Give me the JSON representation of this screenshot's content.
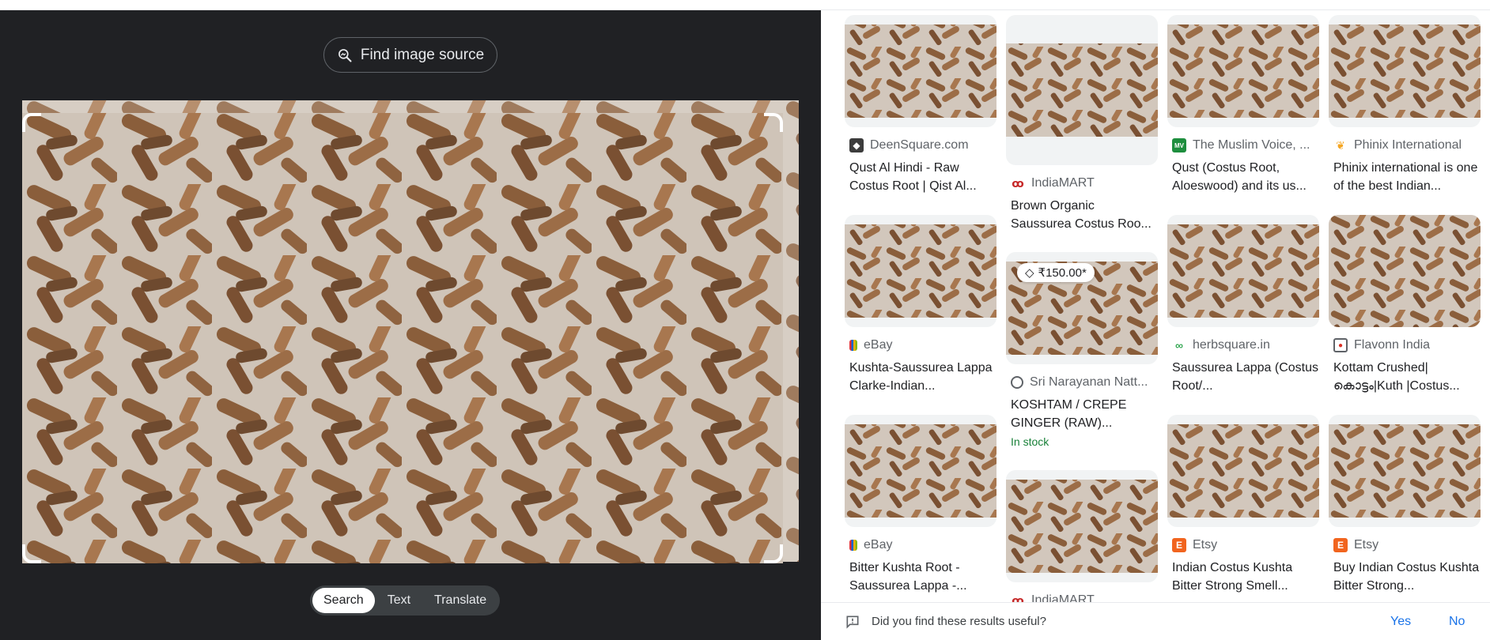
{
  "lens": {
    "find_source_label": "Find image source",
    "modes": [
      "Search",
      "Text",
      "Translate"
    ],
    "active_mode": "Search"
  },
  "results": [
    {
      "source": "DeenSquare.com",
      "title": "Qust Al Hindi - Raw Costus Root | Qist Al...",
      "favicon": "deensquare-icon"
    },
    {
      "source": "IndiaMART",
      "title": "Brown Organic Saussurea Costus Roo...",
      "favicon": "indiamart-icon"
    },
    {
      "source": "The Muslim Voice, ...",
      "title": "Qust (Costus Root, Aloeswood) and its us...",
      "favicon": "muslimvoice-icon"
    },
    {
      "source": "Phinix International",
      "title": "Phinix international is one of the best Indian...",
      "favicon": "phinix-icon"
    },
    {
      "source": "eBay",
      "title": "Kushta-Saussurea Lappa Clarke-Indian...",
      "favicon": "ebay-icon"
    },
    {
      "source": "Sri Narayanan Natt...",
      "title": "KOSHTAM / CREPE GINGER (RAW)...",
      "favicon": "globe-icon",
      "price": "₹150.00*",
      "stock": "In stock"
    },
    {
      "source": "herbsquare.in",
      "title": "Saussurea Lappa (Costus Root/...",
      "favicon": "herbsquare-icon"
    },
    {
      "source": "Flavonn India",
      "title": "Kottam Crushed| കൊട്ടം|Kuth |Costus...",
      "favicon": "flavonn-icon"
    },
    {
      "source": "eBay",
      "title": "Bitter Kushta Root - Saussurea Lappa -...",
      "favicon": "ebay-icon"
    },
    {
      "source": "IndiaMART",
      "title": "",
      "favicon": "indiamart-icon"
    },
    {
      "source": "Etsy",
      "title": "Indian Costus Kushta Bitter Strong Smell...",
      "favicon": "etsy-icon"
    },
    {
      "source": "Etsy",
      "title": "Buy Indian Costus Kushta Bitter Strong...",
      "favicon": "etsy-icon"
    }
  ],
  "feedback": {
    "question": "Did you find these results useful?",
    "yes": "Yes",
    "no": "No"
  },
  "colors": {
    "dark_bg": "#202124",
    "link_blue": "#1a73e8",
    "stock_green": "#188038",
    "etsy_orange": "#f1641e"
  }
}
